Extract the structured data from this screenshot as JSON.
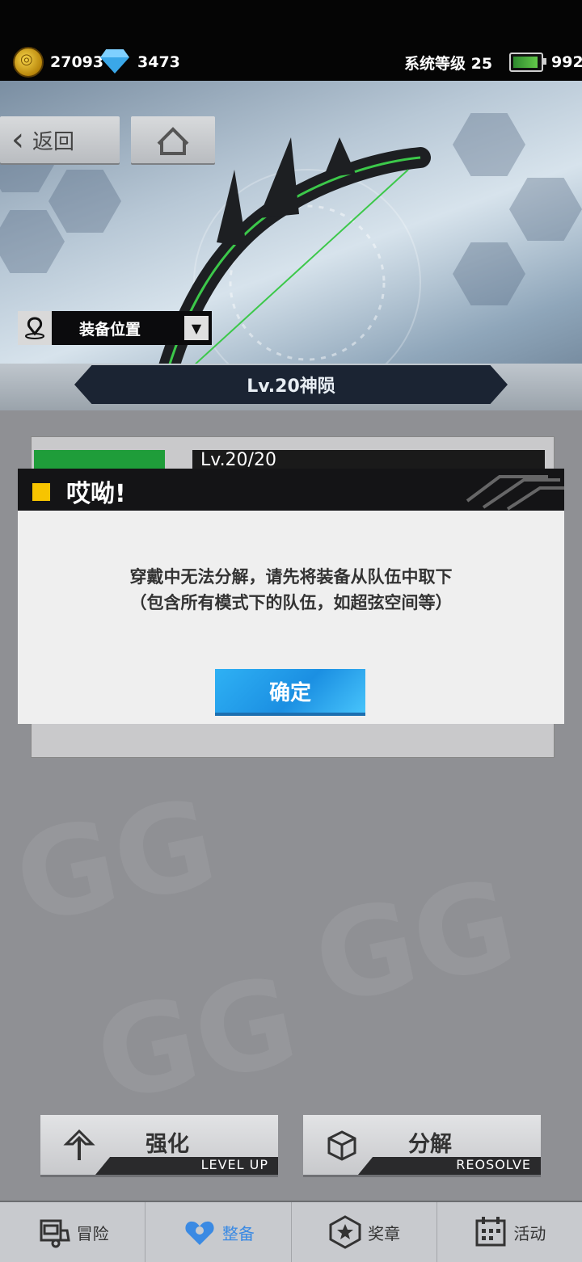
{
  "top_bar": {
    "coins": "27093",
    "gems": "3473",
    "system_level": "系统等级 25",
    "stamina": "992"
  },
  "hero": {
    "back_label": "返回",
    "location_label": "装备位置",
    "item_name": "Lv.20神陨"
  },
  "underlay": {
    "level_text": "Lv.20/20"
  },
  "dialog": {
    "title": "哎呦!",
    "message_line1": "穿戴中无法分解，请先将装备从队伍中取下",
    "message_line2": "（包含所有模式下的队伍，如超弦空间等）",
    "confirm_label": "确定"
  },
  "actions": {
    "enhance_label": "强化",
    "enhance_sub": "LEVEL UP",
    "resolve_label": "分解",
    "resolve_sub": "REOSOLVE"
  },
  "tabs": [
    {
      "label": "冒险",
      "icon": "truck-icon"
    },
    {
      "label": "整备",
      "icon": "heart-gear-icon"
    },
    {
      "label": "奖章",
      "icon": "star-badge-icon"
    },
    {
      "label": "活动",
      "icon": "calendar-icon"
    }
  ],
  "colors": {
    "accent_blue": "#2fb1f4",
    "dialog_mark": "#f7c400",
    "active_tab": "#3b8ae3"
  }
}
